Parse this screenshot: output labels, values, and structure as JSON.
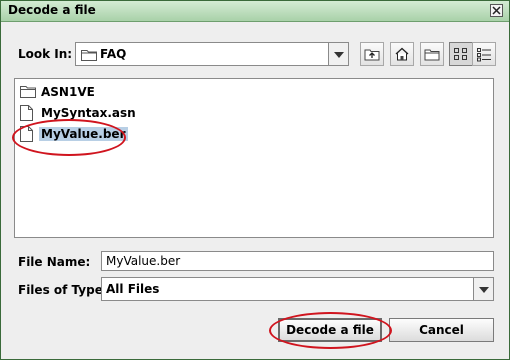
{
  "window": {
    "title": "Decode a file"
  },
  "look_in": {
    "label": "Look In:",
    "value": "FAQ"
  },
  "toolbar": {
    "buttons": [
      "up-one-level",
      "home",
      "new-folder",
      "list-view",
      "details-view"
    ],
    "active": "list-view"
  },
  "files": [
    {
      "name": "ASN1VE",
      "type": "folder"
    },
    {
      "name": "MySyntax.asn",
      "type": "file"
    },
    {
      "name": "MyValue.ber",
      "type": "file",
      "selected": true
    }
  ],
  "file_name": {
    "label": "File Name:",
    "value": "MyValue.ber"
  },
  "files_of_type": {
    "label": "Files of Type:",
    "value": "All Files"
  },
  "actions": {
    "decode_label": "Decode a file",
    "cancel_label": "Cancel"
  },
  "colors": {
    "title_bar": "#a9d1a9",
    "selection": "#b8cfe5",
    "highlight": "#d0141e"
  }
}
